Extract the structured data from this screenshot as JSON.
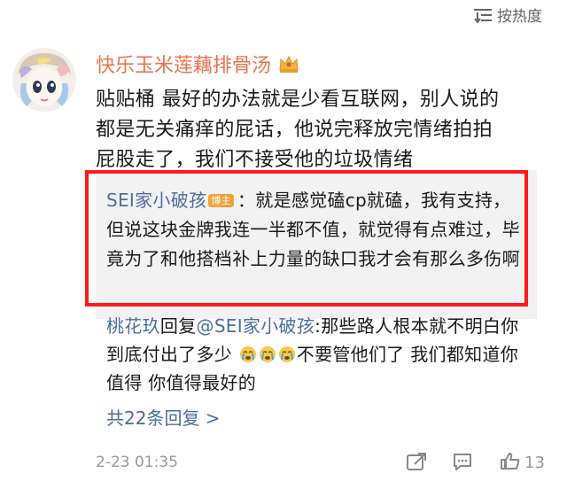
{
  "sort": {
    "label": "按热度"
  },
  "comment": {
    "username": "快乐玉米莲藕排骨汤",
    "text": "贴贴桶 最好的办法就是少看互联网，别人说的都是无关痛痒的屁话，他说完释放完情绪拍拍屁股走了，我们不接受他的垃圾情绪",
    "timestamp": "2-23 01:35",
    "like_count": "13"
  },
  "replies": [
    {
      "author": "SEI家小破孩",
      "badge": "博主",
      "separator": "：",
      "text": "就是感觉磕cp就磕，我有支持，但说这块金牌我连一半都不值，就觉得有点难过，毕竟为了和他搭档补上力量的缺口我才会有那么多伤啊"
    },
    {
      "author": "桃花玖",
      "reply_word": "回复",
      "target": "@SEI家小破孩",
      "separator": ":",
      "text_before": "那些路人根本就不明白你到底付出了多少",
      "text_after": "不要管他们了 我们都知道你值得 你值得最好的",
      "emoji": [
        "crying-face-icon",
        "crying-face-icon",
        "crying-face-icon"
      ]
    }
  ],
  "more_replies": {
    "label": "共22条回复 >"
  },
  "colors": {
    "username": "#eb7350",
    "link": "#4a6e9e",
    "highlight": "#ff1a1a",
    "badge": "#f0a23c",
    "reply_bg": "#f2f2f2"
  }
}
